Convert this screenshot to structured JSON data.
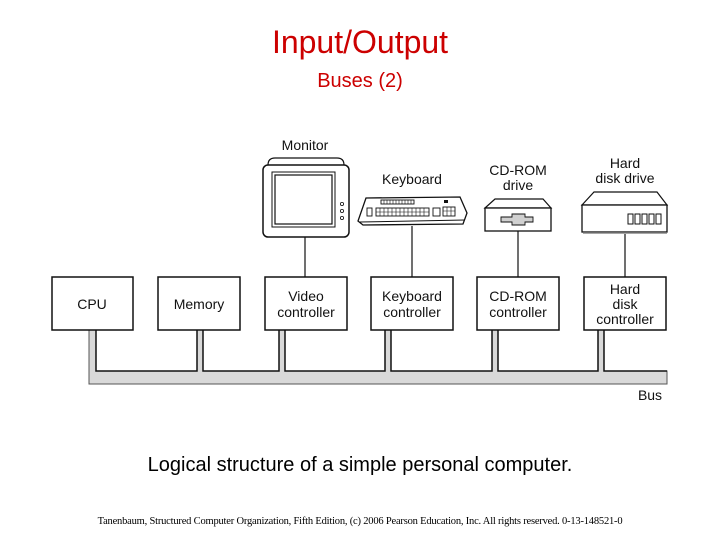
{
  "slide": {
    "title": "Input/Output",
    "subtitle": "Buses (2)",
    "caption": "Logical structure of a simple personal computer.",
    "credit": "Tanenbaum, Structured Computer Organization, Fifth Edition, (c) 2006 Pearson Education, Inc. All rights reserved. 0-13-148521-0"
  },
  "diagram": {
    "bus_label": "Bus",
    "colors": {
      "title": "#cc0000",
      "bus_fill": "#d9d9d9",
      "line": "#111111"
    },
    "components": [
      {
        "id": "cpu",
        "lines": [
          "CPU"
        ]
      },
      {
        "id": "memory",
        "lines": [
          "Memory"
        ]
      },
      {
        "id": "video-controller",
        "lines": [
          "Video",
          "controller"
        ]
      },
      {
        "id": "keyboard-controller",
        "lines": [
          "Keyboard",
          "controller"
        ]
      },
      {
        "id": "cdrom-controller",
        "lines": [
          "CD-ROM",
          "controller"
        ]
      },
      {
        "id": "hard-disk-controller",
        "lines": [
          "Hard",
          "disk",
          "controller"
        ]
      }
    ],
    "devices": [
      {
        "id": "monitor",
        "lines": [
          "Monitor"
        ],
        "icon": "monitor-icon"
      },
      {
        "id": "keyboard",
        "lines": [
          "Keyboard"
        ],
        "icon": "keyboard-icon"
      },
      {
        "id": "cdrom-drive",
        "lines": [
          "CD-ROM",
          "drive"
        ],
        "icon": "cdrom-drive-icon"
      },
      {
        "id": "hard-disk-drive",
        "lines": [
          "Hard",
          "disk drive"
        ],
        "icon": "hard-disk-drive-icon"
      }
    ]
  }
}
